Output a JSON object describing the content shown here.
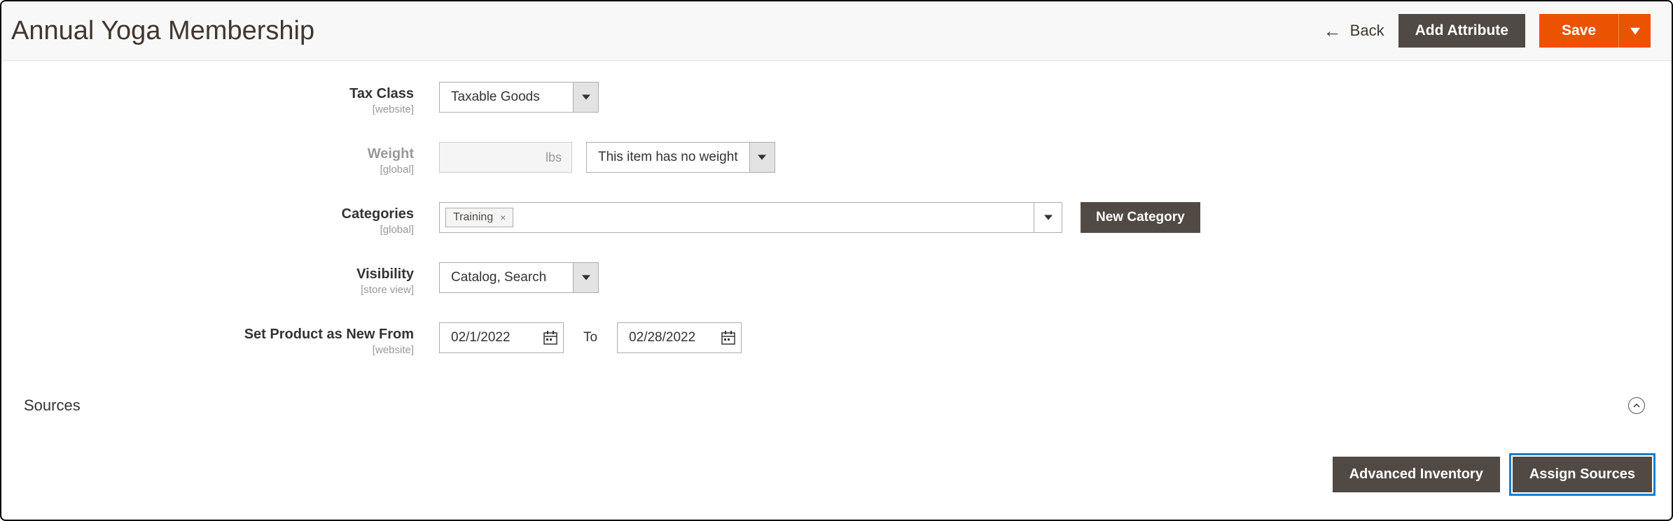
{
  "header": {
    "title": "Annual Yoga Membership",
    "back_label": "Back",
    "add_attribute_label": "Add Attribute",
    "save_label": "Save"
  },
  "fields": {
    "tax_class": {
      "label": "Tax Class",
      "scope": "[website]",
      "value": "Taxable Goods"
    },
    "weight": {
      "label": "Weight",
      "scope": "[global]",
      "unit": "lbs",
      "option": "This item has no weight"
    },
    "categories": {
      "label": "Categories",
      "scope": "[global]",
      "tag": "Training",
      "new_category_label": "New Category"
    },
    "visibility": {
      "label": "Visibility",
      "scope": "[store view]",
      "value": "Catalog, Search"
    },
    "new_from": {
      "label": "Set Product as New From",
      "scope": "[website]",
      "from": "02/1/2022",
      "to_label": "To",
      "to": "02/28/2022"
    }
  },
  "sources": {
    "title": "Sources",
    "advanced_inventory_label": "Advanced Inventory",
    "assign_sources_label": "Assign Sources"
  }
}
